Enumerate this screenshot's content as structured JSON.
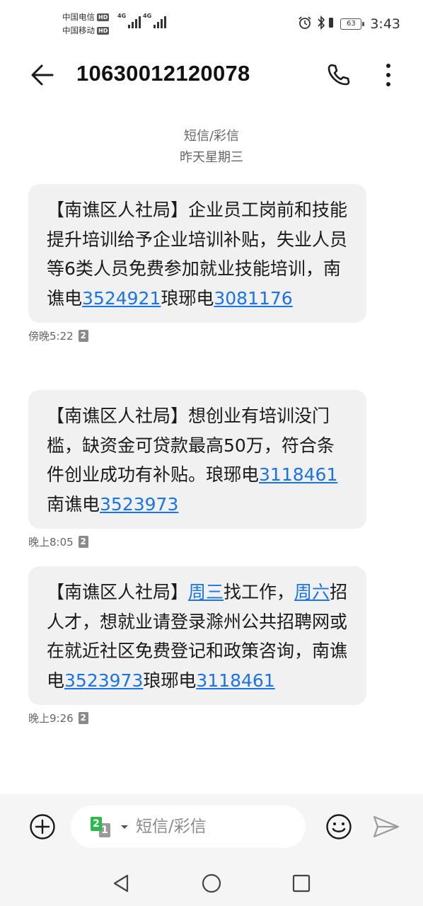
{
  "status_bar": {
    "carrier1": "中国电信",
    "carrier2": "中国移动",
    "hd1": "HD",
    "hd2": "HD",
    "sig1_label": "4G",
    "sig2_label": "4G",
    "battery": "63",
    "time": "3:43"
  },
  "header": {
    "title": "10630012120078",
    "icons": [
      "back-arrow-icon",
      "phone-icon",
      "more-vertical-icon"
    ]
  },
  "thread": {
    "channel": "短信/彩信",
    "date": "昨天星期三"
  },
  "messages": [
    {
      "parts": [
        {
          "text": "【南谯区人社局】企业员工岗前和技能提升培训给予企业培训补贴，失业人员等6类人员免费参加就业技能培训，南谯电",
          "link": false
        },
        {
          "text": "3524921",
          "link": true
        },
        {
          "text": "琅琊电",
          "link": false
        },
        {
          "text": "3081176",
          "link": true
        }
      ],
      "time": "傍晚5:22",
      "sim": "2"
    },
    {
      "parts": [
        {
          "text": "【南谯区人社局】想创业有培训没门槛，缺资金可贷款最高50万，符合条件创业成功有补贴。琅琊电",
          "link": false
        },
        {
          "text": "3118461",
          "link": true
        },
        {
          "text": "南谯电",
          "link": false
        },
        {
          "text": "3523973",
          "link": true
        }
      ],
      "time": "晚上8:05",
      "sim": "2"
    },
    {
      "parts": [
        {
          "text": "【南谯区人社局】",
          "link": false
        },
        {
          "text": "周三",
          "link": true
        },
        {
          "text": "找工作，",
          "link": false
        },
        {
          "text": "周六",
          "link": true
        },
        {
          "text": "招人才，想就业请登录滁州公共招聘网或在就近社区免费登记和政策咨询，南谯电",
          "link": false
        },
        {
          "text": "3523973",
          "link": true
        },
        {
          "text": "琅琊电",
          "link": false
        },
        {
          "text": "3118461",
          "link": true
        }
      ],
      "time": "晚上9:26",
      "sim": "2"
    }
  ],
  "composer": {
    "placeholder": "短信/彩信",
    "sim_primary": "2",
    "sim_secondary": "1",
    "icons": [
      "add-circle-icon",
      "emoji-icon",
      "send-icon"
    ]
  },
  "colors": {
    "link": "#1a73e8",
    "bubble": "#f1f1f1",
    "sim_green": "#2db84b"
  }
}
